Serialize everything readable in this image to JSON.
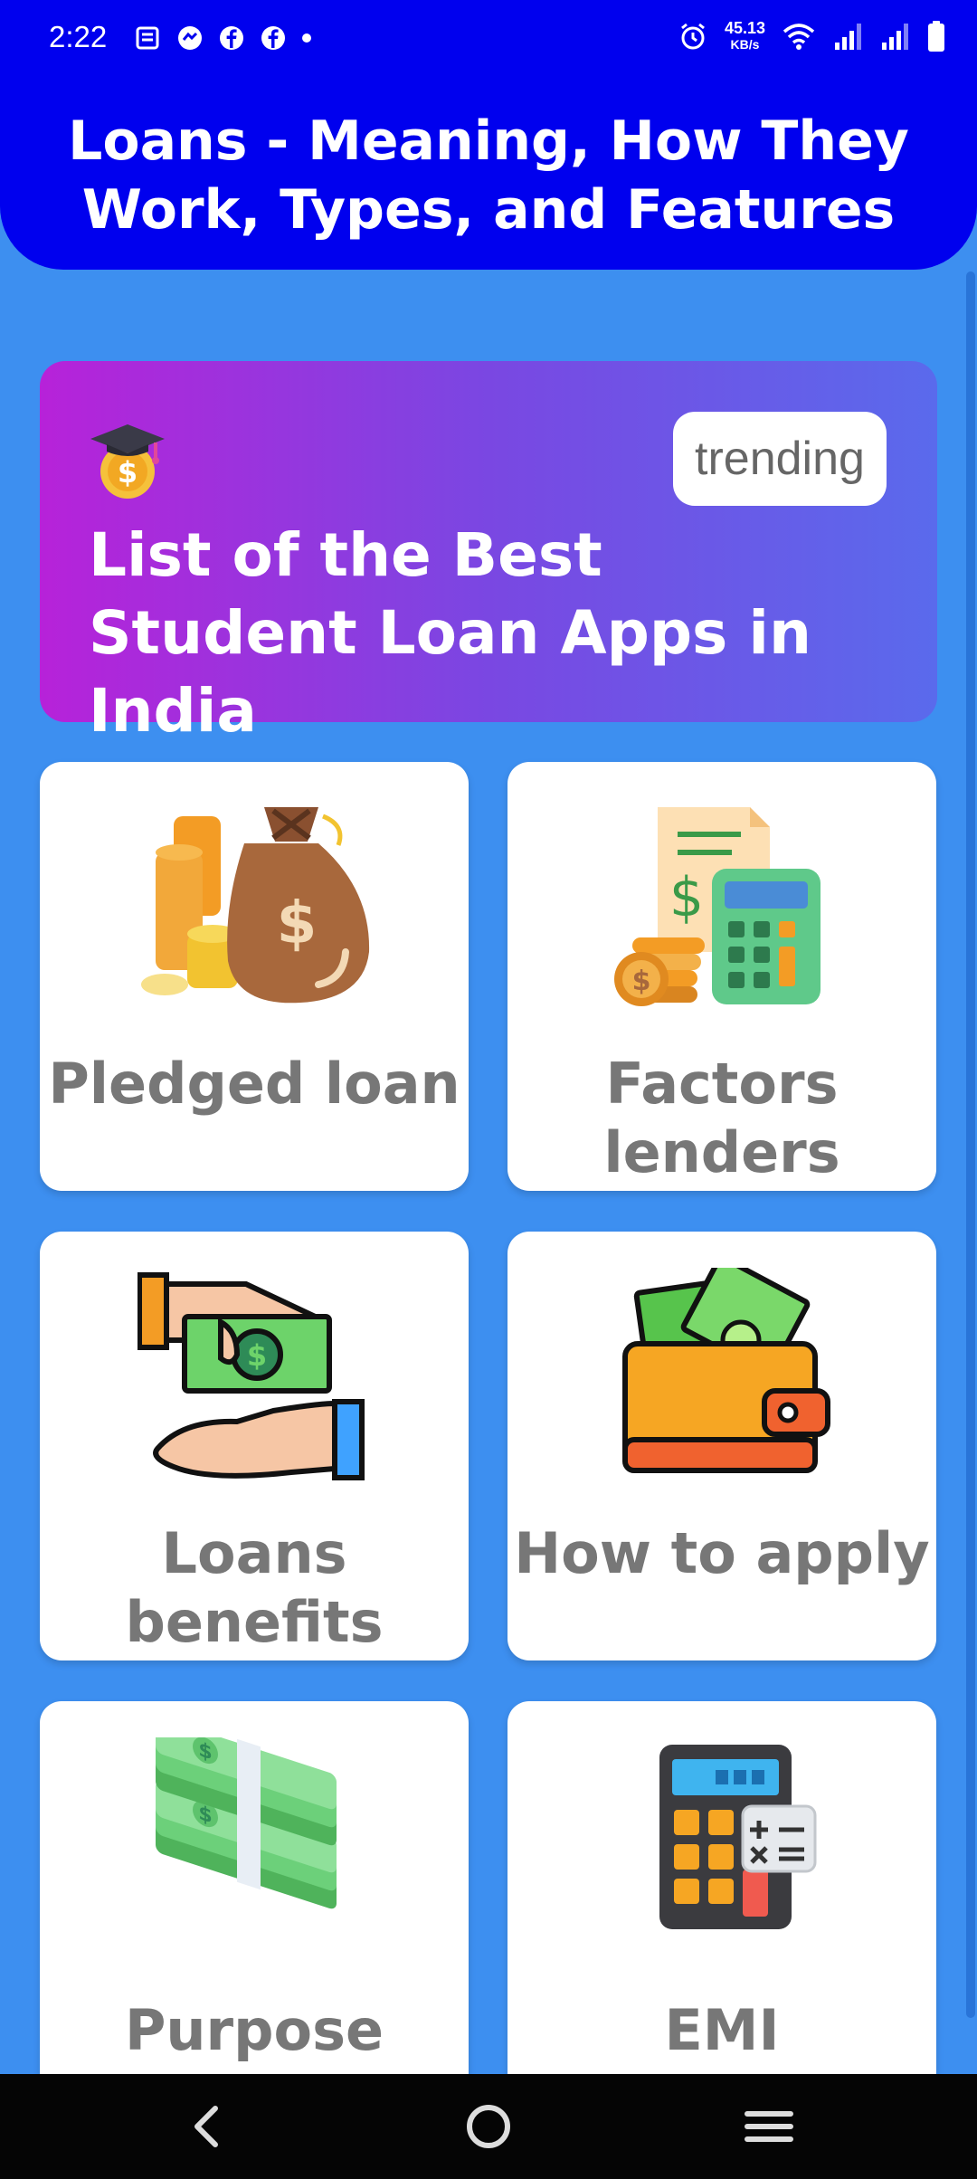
{
  "status_bar": {
    "time": "2:22",
    "net_speed_value": "45.13",
    "net_speed_unit": "KB/s",
    "left_icons": [
      "news-icon",
      "messenger-icon",
      "facebook-icon",
      "facebook-icon",
      "dot-icon"
    ],
    "right_icons": [
      "alarm-icon",
      "wifi-icon",
      "signal-icon",
      "signal-icon",
      "battery-icon"
    ]
  },
  "header": {
    "title": "Loans - Meaning, How They Work, Types, and Features"
  },
  "banner": {
    "badge": "trending",
    "title": "List of the Best Student Loan Apps in India",
    "icon": "graduation-coin-icon"
  },
  "cards": [
    {
      "label": "Pledged loan",
      "icon": "money-bag-icon"
    },
    {
      "label": "Factors lenders",
      "icon": "calculator-bill-icon"
    },
    {
      "label": "Loans benefits",
      "icon": "hand-cash-icon"
    },
    {
      "label": "How to apply",
      "icon": "wallet-icon"
    },
    {
      "label": "Purpose",
      "icon": "cash-stack-icon"
    },
    {
      "label": "EMI",
      "icon": "calculator-icon"
    }
  ],
  "nav_bar": {
    "buttons": [
      "back-icon",
      "home-icon",
      "recents-icon"
    ]
  },
  "colors": {
    "header": "#0000ee",
    "background": "#3d8ff0",
    "banner_start": "#b722d9",
    "banner_end": "#5a6aec",
    "card_text": "#777777"
  }
}
